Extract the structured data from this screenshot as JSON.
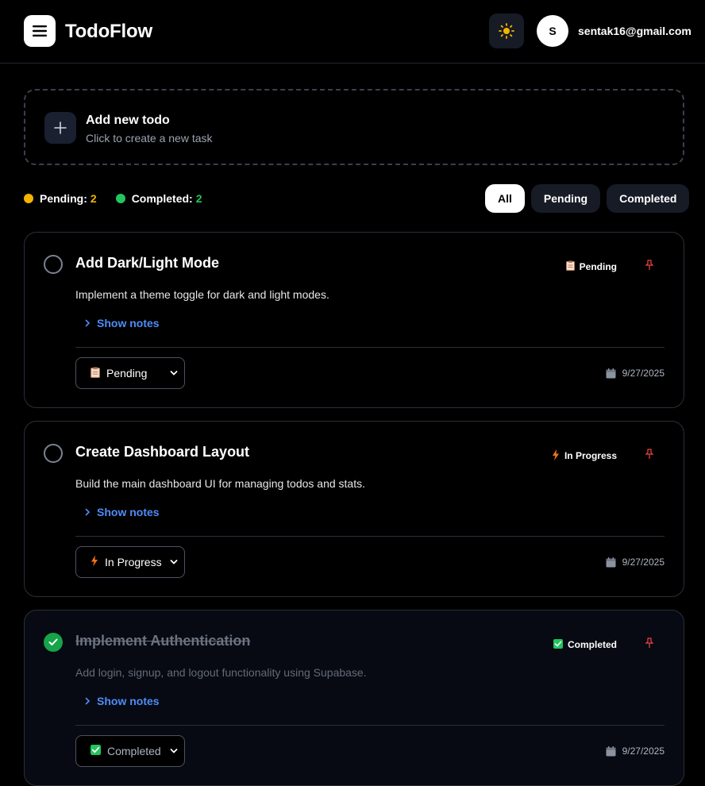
{
  "header": {
    "app_title": "TodoFlow",
    "avatar_initial": "S",
    "email": "sentak16@gmail.com"
  },
  "add_todo": {
    "title": "Add new todo",
    "subtitle": "Click to create a new task"
  },
  "stats": {
    "pending_label": "Pending:",
    "pending_count": "2",
    "completed_label": "Completed:",
    "completed_count": "2"
  },
  "filters": [
    "All",
    "Pending",
    "Completed"
  ],
  "active_filter": "All",
  "todos": [
    {
      "title": "Add Dark/Light Mode",
      "description": "Implement a theme toggle for dark and light modes.",
      "status_label": "Pending",
      "status_icon": "clipboard-icon",
      "notes_label": "Show notes",
      "select_value": "Pending",
      "date": "9/27/2025",
      "completed": false
    },
    {
      "title": "Create Dashboard Layout",
      "description": "Build the main dashboard UI for managing todos and stats.",
      "status_label": "In Progress",
      "status_icon": "lightning-icon",
      "notes_label": "Show notes",
      "select_value": "In Progress",
      "date": "9/27/2025",
      "completed": false
    },
    {
      "title": "Implement Authentication",
      "description": "Add login, signup, and logout functionality using Supabase.",
      "status_label": "Completed",
      "status_icon": "check-box-icon",
      "notes_label": "Show notes",
      "select_value": "Completed",
      "date": "9/27/2025",
      "completed": true
    }
  ],
  "colors": {
    "pending": "#f5b400",
    "completed": "#22c55e",
    "link": "#4f8cf7",
    "pin": "#ef4444"
  }
}
